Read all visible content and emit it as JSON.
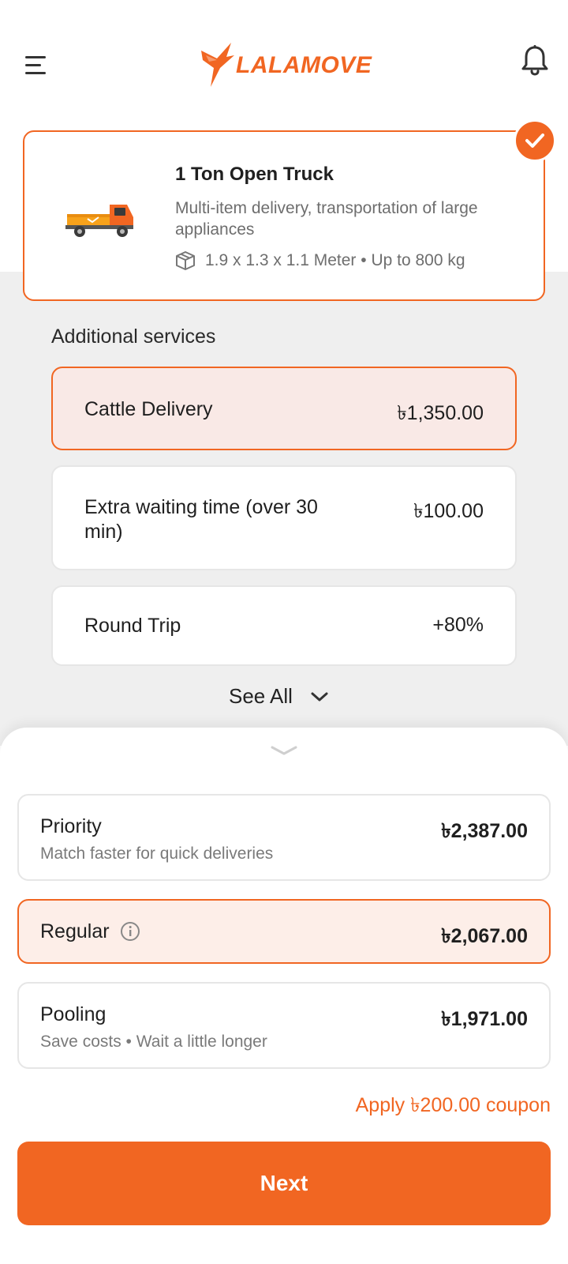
{
  "header": {
    "brand": "LALAMOVE",
    "menu_icon": "hamburger-menu-icon",
    "notification_icon": "bell-icon"
  },
  "vehicle": {
    "title": "1 Ton Open Truck",
    "description": "Multi-item delivery, transportation of large appliances",
    "spec": "1.9 x 1.3 x 1.1 Meter • Up to 800 kg",
    "selected": true
  },
  "additional_services": {
    "title": "Additional services",
    "items": [
      {
        "label": "Cattle Delivery",
        "price": "৳1,350.00",
        "selected": true
      },
      {
        "label": "Extra waiting time (over 30 min)",
        "price": "৳100.00",
        "selected": false
      },
      {
        "label": "Round Trip",
        "price": "+80%",
        "selected": false
      }
    ],
    "see_all": "See All"
  },
  "delivery_options": [
    {
      "name": "Priority",
      "subtitle": "Match faster for quick deliveries",
      "price": "৳2,387.00",
      "selected": false
    },
    {
      "name": "Regular",
      "subtitle": "",
      "price": "৳2,067.00",
      "selected": true
    },
    {
      "name": "Pooling",
      "subtitle": "Save costs • Wait a little longer",
      "price": "৳1,971.00",
      "selected": false
    }
  ],
  "coupon_link": "Apply ৳200.00 coupon",
  "next_button": "Next",
  "colors": {
    "accent": "#f16622",
    "selected_service_bg": "#f9e9e6",
    "selected_option_bg": "#fdeee8",
    "page_gray": "#efefef"
  }
}
